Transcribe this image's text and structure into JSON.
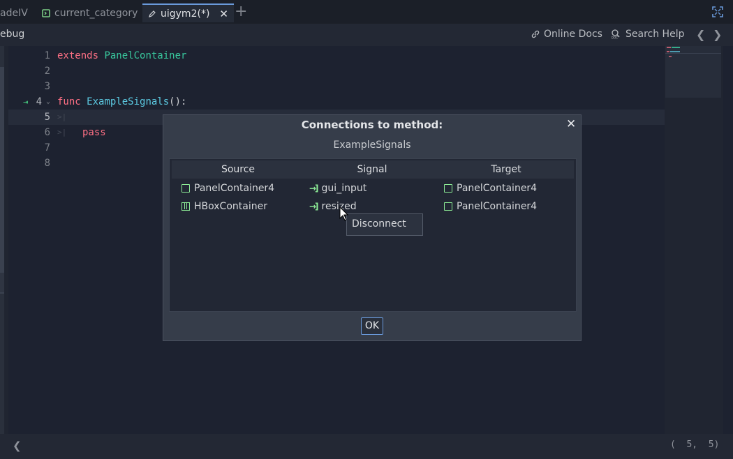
{
  "tabs": [
    {
      "label": "adeIV",
      "icon": "none"
    },
    {
      "label": "current_category",
      "icon": "script-icon"
    },
    {
      "label": "uigym2(*)",
      "icon": "edit-script-icon",
      "active": true
    }
  ],
  "menubar": {
    "debug_label": "ebug",
    "online_docs": "Online Docs",
    "search_help": "Search Help",
    "prev": "❮",
    "next": "❯"
  },
  "editor": {
    "lines": [
      {
        "n": "1"
      },
      {
        "n": "2"
      },
      {
        "n": "3"
      },
      {
        "n": "4"
      },
      {
        "n": "5"
      },
      {
        "n": "6"
      },
      {
        "n": "7"
      },
      {
        "n": "8"
      }
    ],
    "code": {
      "extends_kw": "extends",
      "extends_type": "PanelContainer",
      "func_kw": "func",
      "func_name": "ExampleSignals",
      "func_tail": "():",
      "pass_kw": "pass"
    }
  },
  "statusbar": {
    "left_arrow": "❮",
    "position": "(  5,  5)"
  },
  "dialog": {
    "title": "Connections to method:",
    "close": "✕",
    "method": "ExampleSignals",
    "columns": [
      "Source",
      "Signal",
      "Target"
    ],
    "rows": [
      {
        "source": "PanelContainer4",
        "source_icon": "panel-container-icon",
        "signal": "gui_input",
        "target": "PanelContainer4"
      },
      {
        "source": "HBoxContainer",
        "source_icon": "hbox-container-icon",
        "signal": "resized",
        "target": "PanelContainer4"
      }
    ],
    "ok_label": "OK"
  },
  "context_menu": {
    "item": "Disconnect"
  },
  "colors": {
    "accent": "#6a9adb",
    "node_green": "#8eef97",
    "keyword": "#ff7085"
  }
}
